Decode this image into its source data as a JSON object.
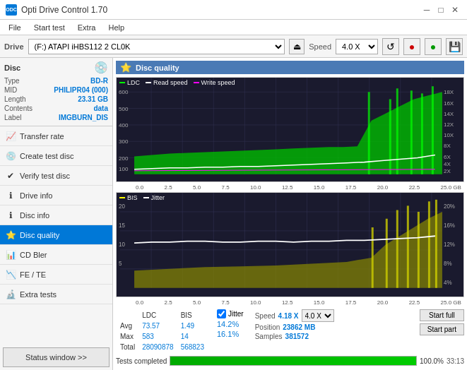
{
  "app": {
    "title": "Opti Drive Control 1.70",
    "icon": "ODC"
  },
  "titlebar": {
    "minimize": "─",
    "maximize": "□",
    "close": "✕"
  },
  "menubar": {
    "items": [
      "File",
      "Start test",
      "Extra",
      "Help"
    ]
  },
  "drivebar": {
    "label": "Drive",
    "drive_value": "(F:)  ATAPI iHBS112  2 CL0K",
    "speed_label": "Speed",
    "speed_value": "4.0 X",
    "eject_icon": "⏏"
  },
  "disc": {
    "section_title": "Disc",
    "type_label": "Type",
    "type_value": "BD-R",
    "mid_label": "MID",
    "mid_value": "PHILIPR04 (000)",
    "length_label": "Length",
    "length_value": "23.31 GB",
    "contents_label": "Contents",
    "contents_value": "data",
    "label_label": "Label",
    "label_value": "IMGBURN_DIS"
  },
  "nav": {
    "items": [
      {
        "id": "transfer-rate",
        "label": "Transfer rate",
        "active": false
      },
      {
        "id": "create-test-disc",
        "label": "Create test disc",
        "active": false
      },
      {
        "id": "verify-test-disc",
        "label": "Verify test disc",
        "active": false
      },
      {
        "id": "drive-info",
        "label": "Drive info",
        "active": false
      },
      {
        "id": "disc-info",
        "label": "Disc info",
        "active": false
      },
      {
        "id": "disc-quality",
        "label": "Disc quality",
        "active": true
      },
      {
        "id": "cd-bler",
        "label": "CD Bler",
        "active": false
      },
      {
        "id": "fe-te",
        "label": "FE / TE",
        "active": false
      },
      {
        "id": "extra-tests",
        "label": "Extra tests",
        "active": false
      }
    ],
    "status_btn": "Status window >>"
  },
  "disc_quality": {
    "title": "Disc quality",
    "legend": {
      "ldc": {
        "label": "LDC",
        "color": "#00ff00"
      },
      "read_speed": {
        "label": "Read speed",
        "color": "#ffffff"
      },
      "write_speed": {
        "label": "Write speed",
        "color": "#ff00ff"
      }
    },
    "legend2": {
      "bis": {
        "label": "BIS",
        "color": "#ffff00"
      },
      "jitter": {
        "label": "Jitter",
        "color": "#ffffff"
      }
    },
    "x_axis": [
      "0.0",
      "2.5",
      "5.0",
      "7.5",
      "10.0",
      "12.5",
      "15.0",
      "17.5",
      "20.0",
      "22.5",
      "25.0 GB"
    ],
    "y_axis_top_right": [
      "18X",
      "16X",
      "14X",
      "12X",
      "10X",
      "8X",
      "6X",
      "4X",
      "2X"
    ],
    "y_axis_top_left": [
      "600",
      "500",
      "400",
      "300",
      "200",
      "100"
    ],
    "y_axis_bot_right": [
      "20%",
      "16%",
      "12%",
      "8%",
      "4%"
    ],
    "y_axis_bot_left": [
      "20",
      "15",
      "10",
      "5"
    ],
    "stats": {
      "avg_ldc": "73.57",
      "avg_bis": "1.49",
      "avg_jitter": "14.2%",
      "max_ldc": "583",
      "max_bis": "14",
      "max_jitter": "16.1%",
      "total_ldc": "28090878",
      "total_bis": "568823",
      "speed_label": "Speed",
      "speed_val": "4.18 X",
      "speed_target": "4.0 X",
      "position_label": "Position",
      "position_val": "23862 MB",
      "samples_label": "Samples",
      "samples_val": "381572",
      "jitter_checked": true,
      "jitter_label": "Jitter"
    },
    "buttons": {
      "start_full": "Start full",
      "start_part": "Start part"
    },
    "progress": {
      "label": "Tests completed",
      "pct": "100.0%",
      "value": 100,
      "time": "33:13"
    }
  },
  "statusbar": {
    "text": "Tests completed"
  }
}
